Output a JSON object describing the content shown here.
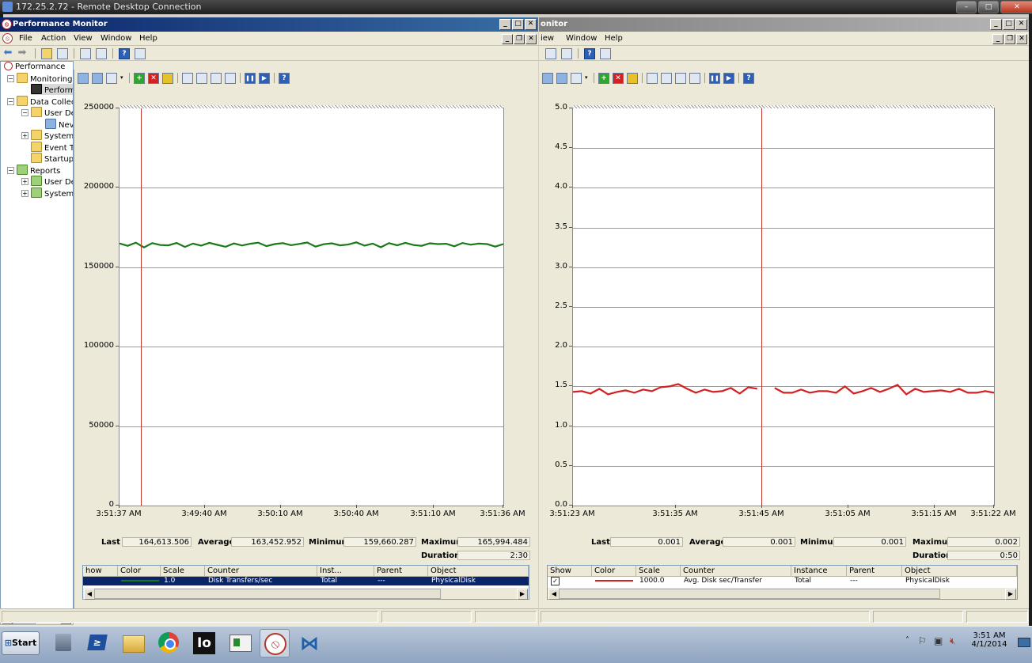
{
  "rdp": {
    "title": "172.25.2.72 - Remote Desktop Connection",
    "min": "–",
    "max": "□",
    "close": "✕"
  },
  "window_left": {
    "title": "Performance Monitor",
    "menu": [
      "File",
      "Action",
      "View",
      "Window",
      "Help"
    ],
    "tree": [
      "Performance",
      "Monitoring",
      "Perform",
      "Data Collec",
      "User De",
      "Nev",
      "System",
      "Event T",
      "Startup",
      "Reports",
      "User De",
      "System"
    ],
    "graph": {
      "y_ticks": [
        "250000",
        "200000",
        "150000",
        "100000",
        "50000",
        "0"
      ],
      "x_ticks": [
        "3:51:37 AM",
        "3:49:40 AM",
        "3:50:10 AM",
        "3:50:40 AM",
        "3:51:10 AM",
        "3:51:36 AM"
      ],
      "stats": {
        "last_label": "Last",
        "last": "164,613.506",
        "average_label": "Average",
        "average": "163,452.952",
        "minimum_label": "Minimum",
        "minimum": "159,660.287",
        "maximum_label": "Maximum",
        "maximum": "165,994.484",
        "duration_label": "Duration",
        "duration": "2:30"
      },
      "legend_headers": [
        "how",
        "Color",
        "Scale",
        "Counter",
        "Inst...",
        "Parent",
        "Object"
      ],
      "legend_row": {
        "scale": "1.0",
        "counter": "Disk Transfers/sec",
        "instance": "Total",
        "parent": "---",
        "object": "PhysicalDisk"
      },
      "line_color": "#1a7a1a",
      "cursor_color": "#c0392b"
    }
  },
  "window_right": {
    "title": "onitor",
    "menu": [
      "iew",
      "Window",
      "Help"
    ],
    "graph": {
      "y_ticks": [
        "5.0",
        "4.5",
        "4.0",
        "3.5",
        "3.0",
        "2.5",
        "2.0",
        "1.5",
        "1.0",
        "0.5",
        "0.0"
      ],
      "x_ticks": [
        "3:51:23 AM",
        "3:51:35 AM",
        "3:51:45 AM",
        "3:51:05 AM",
        "3:51:15 AM",
        "3:51:22 AM"
      ],
      "stats": {
        "last_label": "Last",
        "last": "0.001",
        "average_label": "Average",
        "average": "0.001",
        "minimum_label": "Minimum",
        "minimum": "0.001",
        "maximum_label": "Maximum",
        "maximum": "0.002",
        "duration_label": "Duration",
        "duration": "0:50"
      },
      "legend_headers": [
        "Show",
        "Color",
        "Scale",
        "Counter",
        "Instance",
        "Parent",
        "Object"
      ],
      "legend_row": {
        "scale": "1000.0",
        "counter": "Avg. Disk sec/Transfer",
        "instance": "Total",
        "parent": "---",
        "object": "PhysicalDisk"
      },
      "line_color": "#d42020",
      "cursor_color": "#c0392b"
    }
  },
  "chart_data": [
    {
      "type": "line",
      "title": "",
      "xlabel": "",
      "ylabel": "",
      "ylim": [
        0,
        250000
      ],
      "categories": [
        "3:51:37 AM",
        "3:49:40 AM",
        "3:50:10 AM",
        "3:50:40 AM",
        "3:51:10 AM",
        "3:51:36 AM"
      ],
      "series": [
        {
          "name": "Disk Transfers/sec",
          "values": [
            165000,
            163500,
            165500,
            162500,
            165200,
            164000,
            163800,
            165300,
            162800,
            164900,
            163600,
            165400,
            164100,
            162900,
            165000,
            163700,
            164800,
            165500,
            163300,
            164600,
            165200,
            163900,
            164700,
            165600,
            163000,
            164500,
            165100,
            163800,
            164300,
            165700,
            163600,
            164900,
            162600,
            165200,
            163800,
            165400,
            164000,
            163500,
            165100,
            164600,
            164800,
            163200,
            165300,
            164200,
            164900,
            164600,
            163000,
            164613
          ]
        }
      ],
      "cursor_fraction": 0.055,
      "grid": true
    },
    {
      "type": "line",
      "title": "",
      "xlabel": "",
      "ylabel": "",
      "ylim": [
        0,
        5
      ],
      "categories": [
        "3:51:23 AM",
        "3:51:35 AM",
        "3:51:45 AM",
        "3:51:05 AM",
        "3:51:15 AM",
        "3:51:22 AM"
      ],
      "series": [
        {
          "name": "Avg. Disk sec/Transfer",
          "values": [
            1.43,
            1.44,
            1.41,
            1.47,
            1.4,
            1.43,
            1.45,
            1.42,
            1.46,
            1.44,
            1.49,
            1.5,
            1.53,
            1.47,
            1.42,
            1.46,
            1.43,
            1.44,
            1.48,
            1.41,
            1.49,
            1.47,
            null,
            1.48,
            1.42,
            1.42,
            1.46,
            1.42,
            1.44,
            1.44,
            1.42,
            1.5,
            1.41,
            1.44,
            1.48,
            1.43,
            1.47,
            1.52,
            1.4,
            1.47,
            1.43,
            1.44,
            1.45,
            1.43,
            1.47,
            1.42,
            1.42,
            1.44,
            1.42
          ]
        }
      ],
      "cursor_fraction": 0.447,
      "grid": true
    }
  ],
  "taskbar": {
    "start_label": "Start",
    "apps": [
      "server-manager",
      "powershell",
      "explorer",
      "chrome",
      "iometer",
      "task-manager",
      "performance-monitor",
      "hyper-v"
    ],
    "io_label": "Io",
    "clock_time": "3:51 AM",
    "clock_date": "4/1/2014"
  }
}
